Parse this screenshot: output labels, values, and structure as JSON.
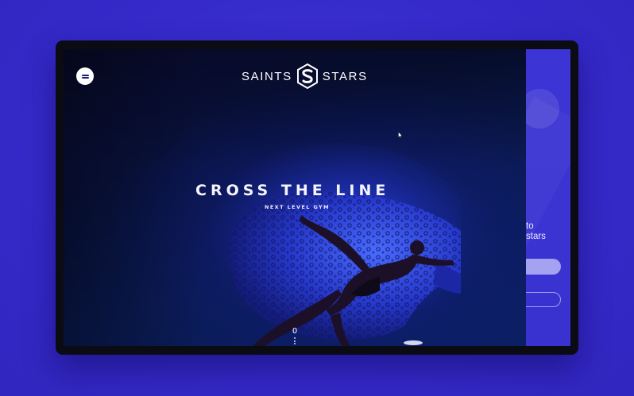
{
  "header": {
    "logo_left": "SAINTS",
    "logo_right": "STARS"
  },
  "hero": {
    "title": "CROSS THE LINE",
    "subtitle": "NEXT LEVEL GYM"
  },
  "scroll": {
    "number": "0"
  },
  "side_panel": {
    "text_line1": "to",
    "text_line2": "stars"
  },
  "icons": {
    "menu": "menu-icon",
    "logo": "saints-stars-s-logo-icon",
    "avatar": "user-avatar-icon",
    "cursor": "mouse-cursor-icon"
  },
  "colors": {
    "background": "#3a30d0",
    "device_frame": "#0b0b14",
    "hero_dark": "#0a0d3a",
    "accent_blue": "#2f3fe0",
    "panel": "#3c34d4",
    "text": "#ffffff"
  }
}
